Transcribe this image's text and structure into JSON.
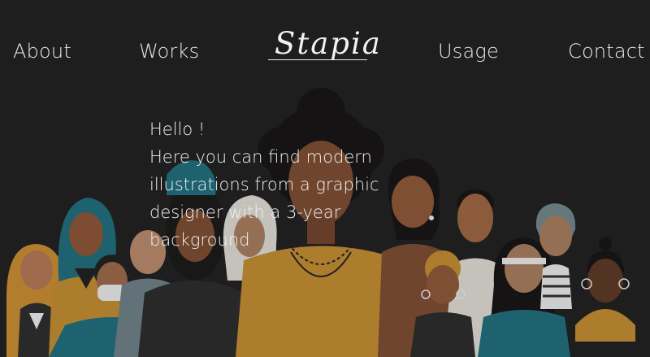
{
  "nav": {
    "about": "About",
    "works": "Works",
    "usage": "Usage",
    "contact": "Contact"
  },
  "logo": {
    "text": "Stapia"
  },
  "hero": {
    "greeting": "Hello !",
    "lines": [
      "Here you can find modern",
      "illustrations from a graphic",
      "designer with a 3-year",
      "background"
    ]
  },
  "illustration": {
    "icon": "diverse-people-illustration"
  },
  "colors": {
    "background": "#1f1e1f",
    "text": "#f0f0f0",
    "mustard": "#c08a2f",
    "teal": "#1d6c79",
    "dark-top": "#2a2a2a"
  }
}
